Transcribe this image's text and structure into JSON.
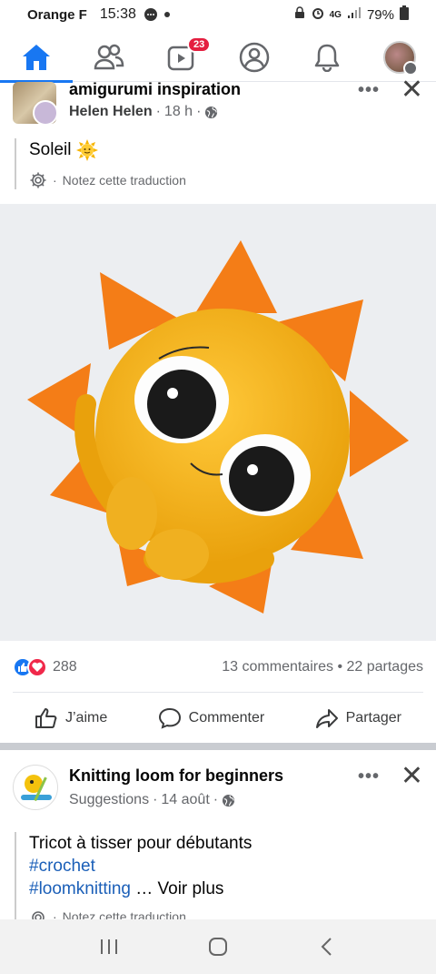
{
  "status_bar": {
    "carrier": "Orange F",
    "time": "15:38",
    "network": "4G",
    "battery": "79%"
  },
  "nav": {
    "items": [
      {
        "name": "home",
        "icon": "home-icon",
        "active": true
      },
      {
        "name": "friends",
        "icon": "friends-icon"
      },
      {
        "name": "watch",
        "icon": "video-icon",
        "badge": "23"
      },
      {
        "name": "profile",
        "icon": "profile-icon"
      },
      {
        "name": "notifications",
        "icon": "bell-icon"
      },
      {
        "name": "menu",
        "icon": "avatar-menu-icon"
      }
    ]
  },
  "post1": {
    "group_name": "amigurumi inspiration",
    "author": "Helen Helen",
    "time": "18 h",
    "privacy_icon": "globe-icon",
    "caption": "Soleil",
    "caption_emoji": "sun-emoji",
    "translate_label": "Notez cette traduction",
    "reaction_count": "288",
    "comments": "13 commentaires",
    "shares": "22 partages",
    "actions": {
      "like": "J’aime",
      "comment": "Commenter",
      "share": "Partager"
    }
  },
  "post2": {
    "page_name": "Knitting loom for beginners",
    "label": "Suggestions",
    "time": "14 août",
    "caption": "Tricot à tisser pour débutants",
    "hashtag1": "#crochet",
    "hashtag2": "#loomknitting",
    "more_text": "… Voir plus",
    "translate_label": "Notez cette traduction"
  },
  "colors": {
    "brand_blue": "#1877f2",
    "badge_red": "#e41e3f",
    "hashtag_blue": "#1b5fb8"
  }
}
